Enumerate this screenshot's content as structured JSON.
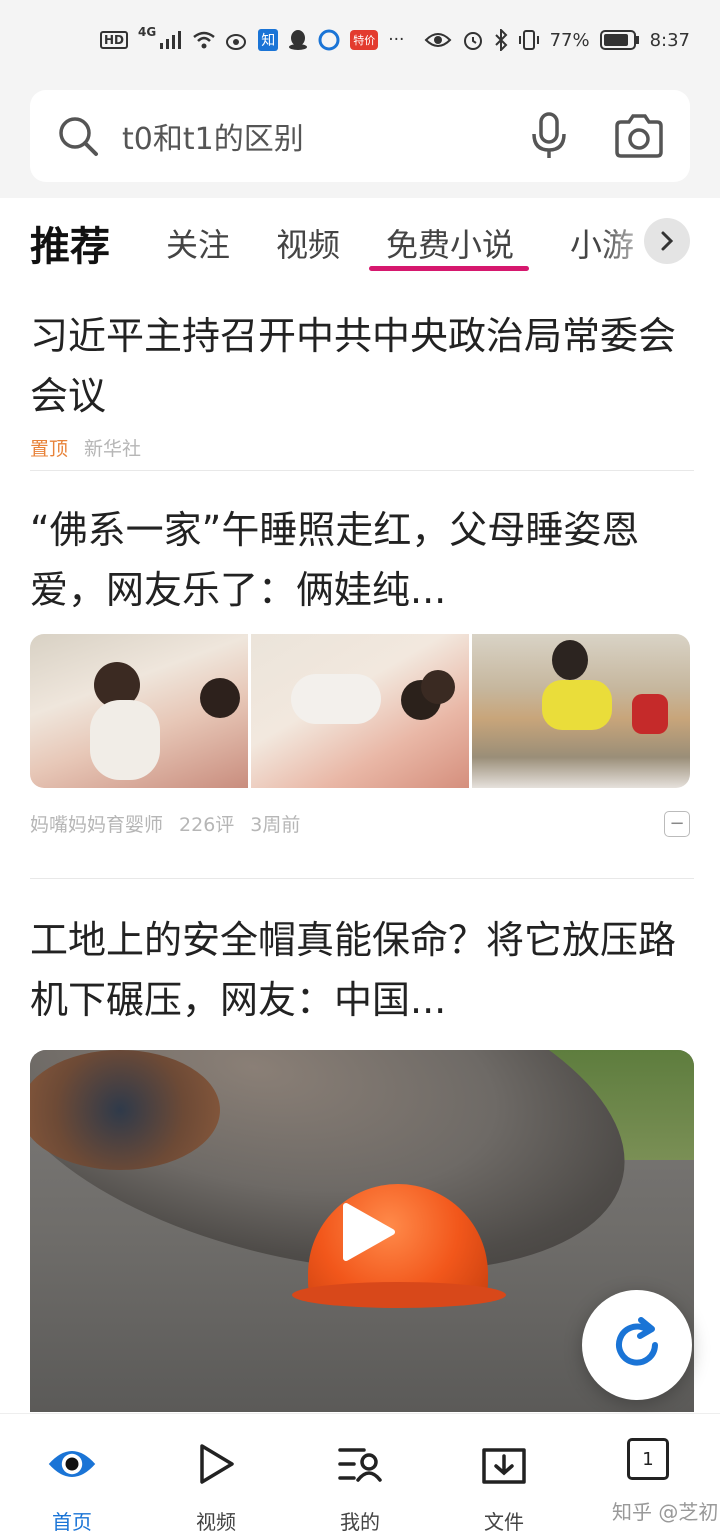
{
  "status_bar": {
    "hd": "HD",
    "network": "4G",
    "app_zhi": "知",
    "app_red": "特价",
    "more": "···",
    "battery_pct": "77%",
    "time": "8:37"
  },
  "search": {
    "value": "t0和t1的区别"
  },
  "tabs": [
    {
      "label": "推荐"
    },
    {
      "label": "关注"
    },
    {
      "label": "视频"
    },
    {
      "label": "免费小说"
    },
    {
      "label": "小游"
    }
  ],
  "articles": [
    {
      "title": "习近平主持召开中共中央政治局常委会会议",
      "pin": "置顶",
      "source": "新华社"
    },
    {
      "title": "“佛系一家”午睡照走红，父母睡姿恩爱，网友乐了：俩娃纯...",
      "source": "妈嘴妈妈育婴师",
      "comments": "226评",
      "time": "3周前",
      "dismiss": "−"
    },
    {
      "title": "工地上的安全帽真能保命？将它放压路机下碾压，网友：中国..."
    }
  ],
  "bottom_nav": [
    {
      "label": "首页",
      "icon": "eye-home-icon"
    },
    {
      "label": "视频",
      "icon": "play-icon"
    },
    {
      "label": "我的",
      "icon": "profile-icon"
    },
    {
      "label": "文件",
      "icon": "download-folder-icon"
    },
    {
      "label": "1",
      "icon": "tabs-icon"
    }
  ],
  "watermark": "知乎 @芝初",
  "colors": {
    "accent_blue": "#1a74d6",
    "tab_underline": "#d6186e",
    "pin_orange": "#e8833a"
  }
}
